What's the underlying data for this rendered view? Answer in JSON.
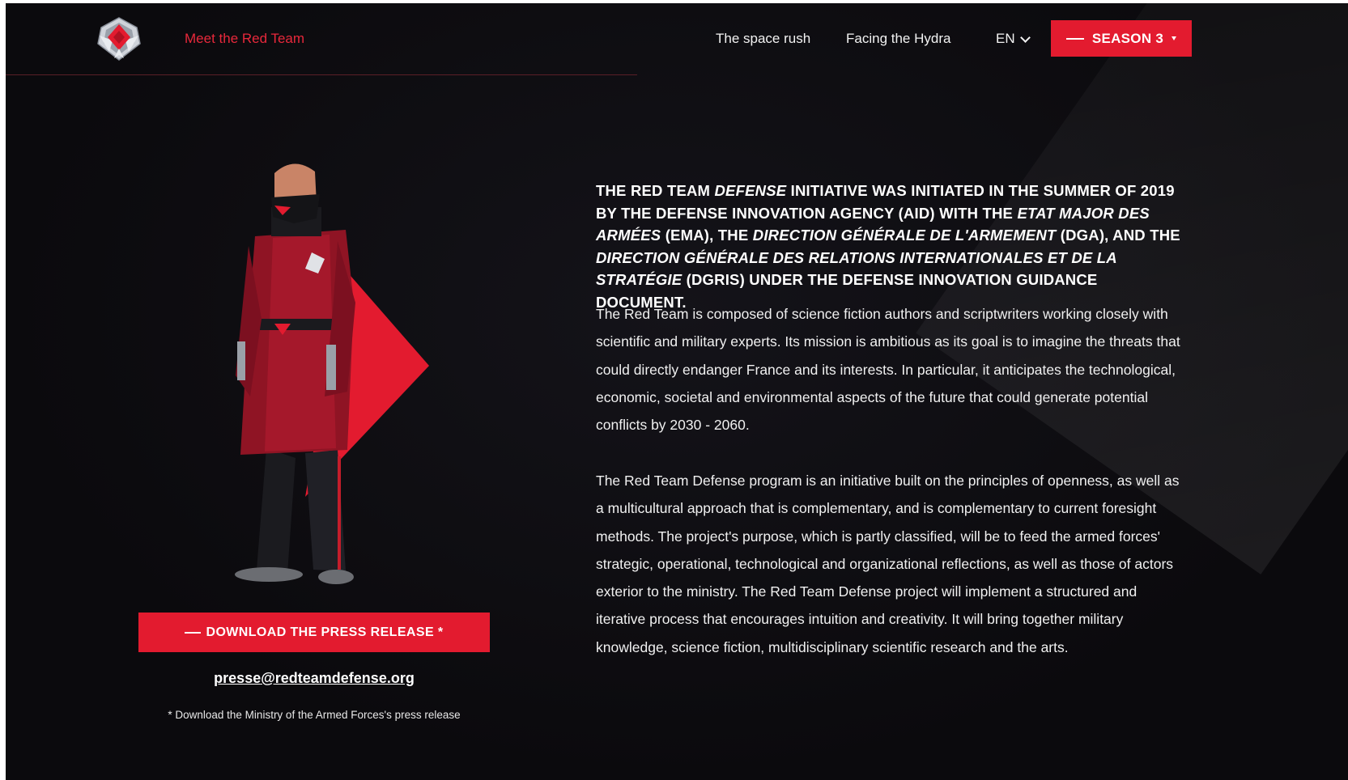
{
  "header": {
    "logo_icon": "red-team-shield-logo-icon",
    "nav_meet": "Meet the Red Team",
    "nav_space": "The space rush",
    "nav_hydra": "Facing the Hydra",
    "lang": "EN",
    "season_label": "SEASON 3"
  },
  "colors": {
    "accent": "#e31b2f",
    "background": "#0d0c10",
    "text": "#ffffff"
  },
  "left": {
    "illustration_icon": "red-team-soldier-illustration",
    "download_label": "DOWNLOAD THE PRESS RELEASE *",
    "email": "presse@redteamdefense.org",
    "footnote": "* Download the Ministry of the Armed Forces's press release"
  },
  "lead": {
    "t1": "THE RED TEAM ",
    "t2": "DEFENSE",
    "t3": " INITIATIVE WAS INITIATED IN THE SUMMER OF 2019 BY THE DEFENSE INNOVATION AGENCY (AID) WITH THE ",
    "t4": "ETAT MAJOR DES ARMÉES",
    "t5": " (EMA), THE ",
    "t6": "DIRECTION GÉNÉRALE DE L'ARMEMENT",
    "t7": " (DGA), AND THE ",
    "t8": "DIRECTION GÉNÉRALE DES RELATIONS INTERNATIONALES ET DE LA STRATÉGIE",
    "t9": " (DGRIS) UNDER THE DEFENSE INNOVATION GUIDANCE DOCUMENT."
  },
  "paragraphs": {
    "p1": "The Red Team is composed of science fiction authors and scriptwriters working closely with scientific and military experts. Its mission is ambitious as its goal is to imagine the threats that could directly endanger France and its interests. In particular, it anticipates the technological, economic, societal and environmental aspects of the future that could generate potential conflicts by 2030 - 2060.",
    "p2": "The Red Team Defense program is an initiative built on the principles of openness, as well as a multicultural approach that is complementary, and is complementary to current foresight methods. The project's purpose, which is partly classified, will be to feed the armed forces' strategic, operational, technological and organizational reflections, as well as those of actors exterior to the ministry. The Red Team Defense project will implement a structured and iterative process that encourages intuition and creativity. It will bring together military knowledge, science fiction, multidisciplinary scientific research and the arts."
  }
}
